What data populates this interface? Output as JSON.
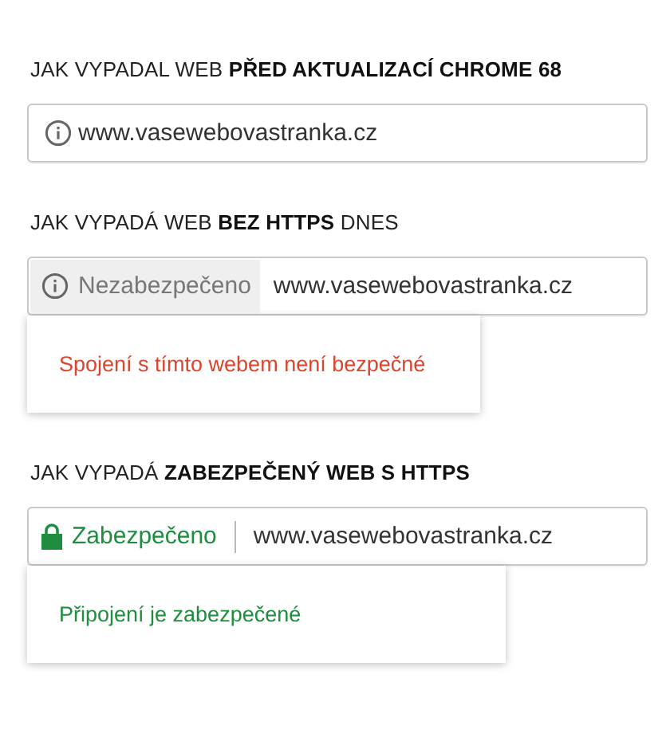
{
  "sections": [
    {
      "heading": "JAK VYPADAL WEB **PŘED AKTUALIZACÍ CHROME 68**",
      "bar": {
        "kind": "plain",
        "url": "www.vasewebovastranka.cz"
      }
    },
    {
      "heading": "JAK VYPADÁ WEB **BEZ HTTPS** DNES",
      "bar": {
        "kind": "insecure",
        "status": "Nezabezpečeno",
        "url": "www.vasewebovastranka.cz"
      },
      "popup": {
        "kind": "insecure",
        "text": "Spojení s tímto webem není bezpečné"
      }
    },
    {
      "heading": "JAK VYPADÁ **ZABEZPEČENÝ WEB S HTTPS**",
      "bar": {
        "kind": "secure",
        "status": "Zabezpečeno",
        "url": "www.vasewebovastranka.cz"
      },
      "popup": {
        "kind": "secure",
        "text": "Připojení je zabezpečené"
      }
    }
  ]
}
